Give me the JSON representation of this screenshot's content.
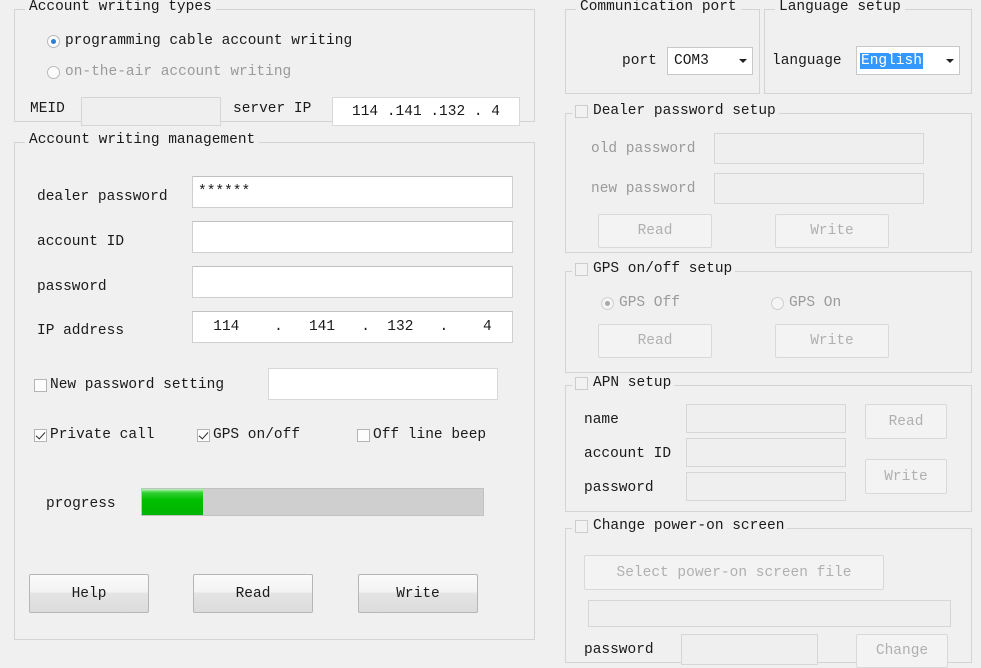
{
  "left": {
    "account_types": {
      "title": "Account writing types",
      "options": [
        {
          "label": "programming cable account writing",
          "selected": true
        },
        {
          "label": "on-the-air account writing",
          "selected": false
        }
      ],
      "meid_label": "MEID",
      "meid_value": "",
      "server_ip_label": "server IP",
      "server_ip_value": "114 .141 .132 . 4"
    },
    "management": {
      "title": "Account writing management",
      "dealer_password_label": "dealer password",
      "dealer_password_value": "******",
      "account_id_label": "account ID",
      "account_id_value": "",
      "password_label": "password",
      "password_value": "",
      "ip_address_label": "IP address",
      "ip_address_value": "114    .   141   .  132   .    4",
      "new_password_label": "New password setting",
      "new_password_checked": false,
      "new_password_value": "",
      "checkboxes": [
        {
          "label": "Private call",
          "checked": true
        },
        {
          "label": "GPS on/off",
          "checked": true
        },
        {
          "label": "Off line beep",
          "checked": false
        }
      ],
      "progress_label": "progress",
      "progress_percent": 18,
      "buttons": [
        "Help",
        "Read",
        "Write"
      ]
    }
  },
  "right": {
    "comm_port": {
      "title": "Communication port",
      "port_label": "port",
      "port_value": "COM3"
    },
    "language": {
      "title": "Language setup",
      "language_label": "language",
      "language_value": "English"
    },
    "dealer_password_setup": {
      "title": "Dealer password setup",
      "enabled": false,
      "old_password_label": "old password",
      "old_password_value": "",
      "new_password_label": "new password",
      "new_password_value": "",
      "read_label": "Read",
      "write_label": "Write"
    },
    "gps_setup": {
      "title": "GPS on/off setup",
      "enabled": false,
      "options": [
        {
          "label": "GPS Off",
          "selected": true
        },
        {
          "label": "GPS On",
          "selected": false
        }
      ],
      "read_label": "Read",
      "write_label": "Write"
    },
    "apn_setup": {
      "title": "APN setup",
      "enabled": false,
      "name_label": "name",
      "name_value": "",
      "account_id_label": "account ID",
      "account_id_value": "",
      "password_label": "password",
      "password_value": "",
      "read_label": "Read",
      "write_label": "Write"
    },
    "power_on_screen": {
      "title": "Change power-on screen",
      "enabled": false,
      "select_file_label": "Select power-on screen file",
      "file_path_value": "",
      "password_label": "password",
      "password_value": "",
      "change_label": "Change"
    }
  },
  "colors": {
    "window_bg": "#f0f0f0",
    "progress_fill": "#00bf00",
    "selection_blue": "#3399ff",
    "radio_dot": "#2a7fd4"
  }
}
